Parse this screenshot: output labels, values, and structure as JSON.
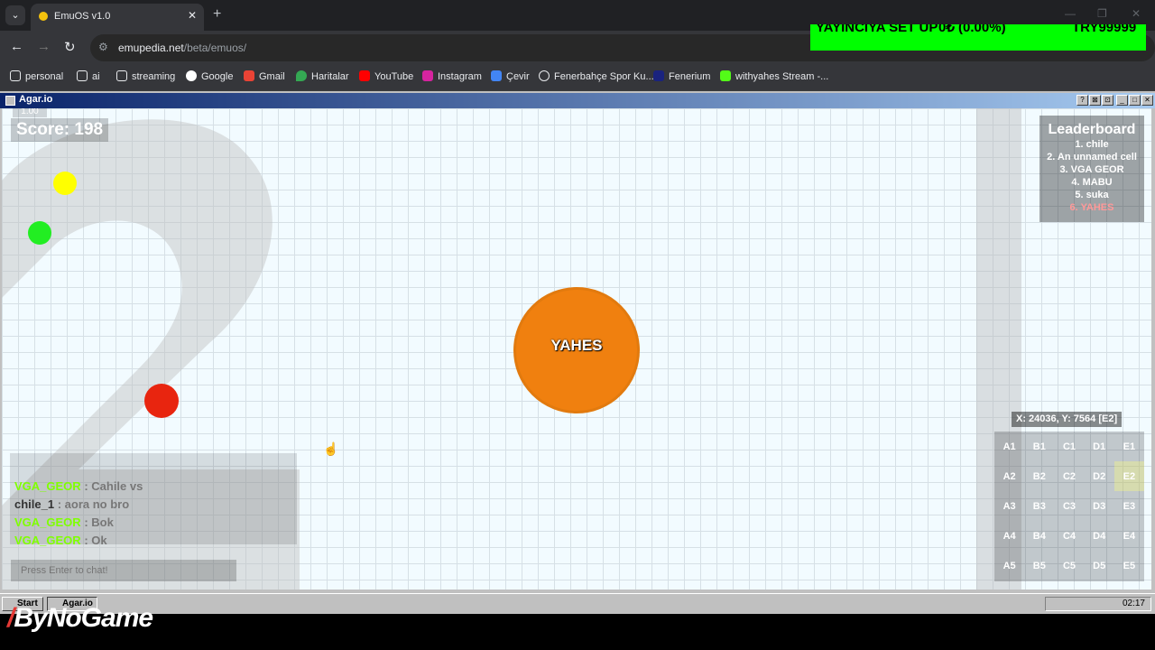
{
  "browser": {
    "tab_title": "EmuOS v1.0",
    "tab_close": "✕",
    "new_tab": "+",
    "url_domain": "emupedia.net",
    "url_path": "/beta/emuos/",
    "bookmarks": [
      {
        "label": "personal",
        "icon": "folder-icon"
      },
      {
        "label": "ai",
        "icon": "folder-icon"
      },
      {
        "label": "streaming",
        "icon": "folder-icon"
      },
      {
        "label": "Google",
        "icon": "google-icon"
      },
      {
        "label": "Gmail",
        "icon": "gmail-icon"
      },
      {
        "label": "Haritalar",
        "icon": "maps-icon"
      },
      {
        "label": "YouTube",
        "icon": "youtube-icon"
      },
      {
        "label": "Instagram",
        "icon": "instagram-icon"
      },
      {
        "label": "Çevir",
        "icon": "translate-icon"
      },
      {
        "label": "Fenerbahçe Spor Ku...",
        "icon": "globe-icon"
      },
      {
        "label": "Fenerium",
        "icon": "fenerium-icon"
      },
      {
        "label": "withyahes Stream -...",
        "icon": "kick-icon"
      }
    ]
  },
  "stream_overlay": {
    "text_left": "YAYINCIYA SET UP",
    "text_mid": "0₺ (0.00%)",
    "text_right": "TRY99999"
  },
  "window": {
    "title": "Agar.io"
  },
  "game": {
    "version": "1.00",
    "score": "Score: 198",
    "player_name": "YAHES",
    "player_color": "#f0800f",
    "pellets": [
      {
        "color": "#ffff00"
      },
      {
        "color": "#22ee22"
      },
      {
        "color": "#e8250f"
      }
    ],
    "leaderboard": {
      "title": "Leaderboard",
      "entries": [
        "1. chile",
        "2. An unnamed cell",
        "3. VGA GEOR",
        "4. MABU",
        "5. suka",
        "6. YAHES"
      ]
    },
    "coords": "X: 24036, Y: 7564 [E2]",
    "minimap": [
      [
        "A1",
        "B1",
        "C1",
        "D1",
        "E1"
      ],
      [
        "A2",
        "B2",
        "C2",
        "D2",
        "E2"
      ],
      [
        "A3",
        "B3",
        "C3",
        "D3",
        "E3"
      ],
      [
        "A4",
        "B4",
        "C4",
        "D4",
        "E4"
      ],
      [
        "A5",
        "B5",
        "C5",
        "D5",
        "E5"
      ]
    ],
    "current_sector": "E2",
    "chat": [
      {
        "user": "VGA_GEOR",
        "text": ": Cahile vs"
      },
      {
        "user": "chile_1",
        "text": ": aora no bro"
      },
      {
        "user": "VGA_GEOR",
        "text": ": Bok"
      },
      {
        "user": "VGA_GEOR",
        "text": ": Ok"
      }
    ],
    "chat_placeholder": "Press Enter to chat!"
  },
  "taskbar": {
    "start_label": "Start",
    "task_label": "Agar.io",
    "clock": "02:17"
  },
  "watermark": "ByNoGame"
}
